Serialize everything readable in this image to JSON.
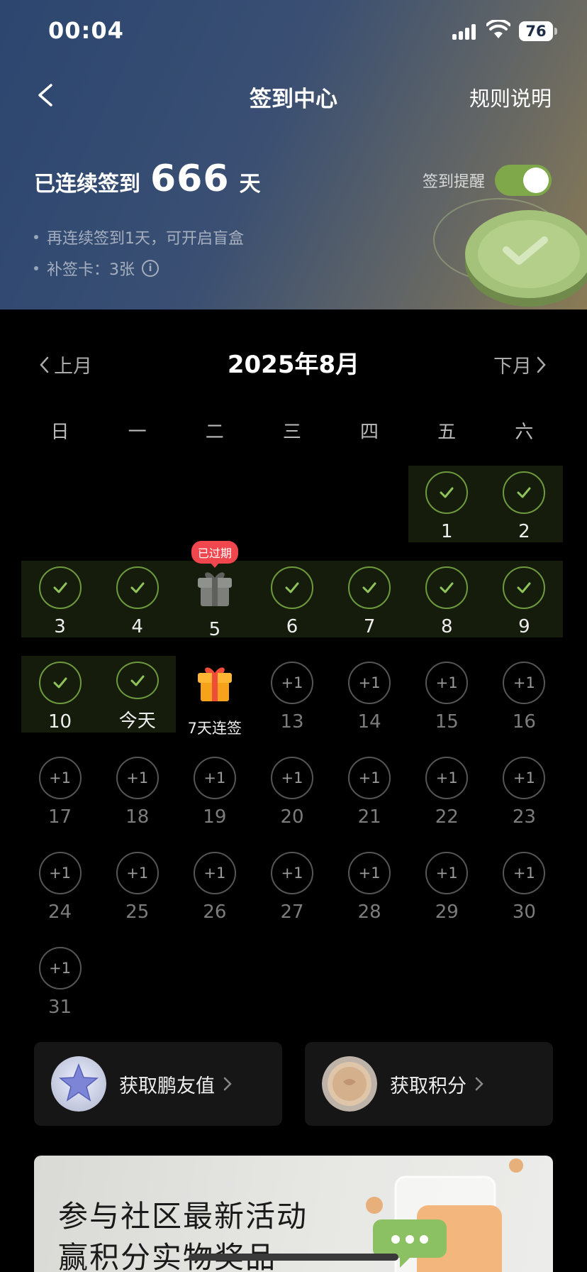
{
  "status_bar": {
    "time": "00:04",
    "battery": "76"
  },
  "nav": {
    "title": "签到中心",
    "rules": "规则说明"
  },
  "streak": {
    "label": "已连续签到",
    "count": "666",
    "unit": "天"
  },
  "reminder": {
    "label": "签到提醒",
    "enabled": true
  },
  "tips": [
    "再连续签到1天，可开启盲盒",
    "补签卡：3张"
  ],
  "calendar": {
    "prev": "上月",
    "next": "下月",
    "title": "2025年8月",
    "weekdays": [
      "日",
      "一",
      "二",
      "三",
      "四",
      "五",
      "六"
    ],
    "expired_badge": "已过期",
    "plus_label": "+1",
    "days": [
      {
        "label": "1",
        "state": "checked"
      },
      {
        "label": "2",
        "state": "checked"
      },
      {
        "label": "3",
        "state": "checked"
      },
      {
        "label": "4",
        "state": "checked"
      },
      {
        "label": "5",
        "state": "expired-gift"
      },
      {
        "label": "6",
        "state": "checked"
      },
      {
        "label": "7",
        "state": "checked"
      },
      {
        "label": "8",
        "state": "checked"
      },
      {
        "label": "9",
        "state": "checked"
      },
      {
        "label": "10",
        "state": "checked"
      },
      {
        "label": "今天",
        "state": "checked"
      },
      {
        "label": "7天连签",
        "state": "gift"
      },
      {
        "label": "13",
        "state": "plus"
      },
      {
        "label": "14",
        "state": "plus"
      },
      {
        "label": "15",
        "state": "plus"
      },
      {
        "label": "16",
        "state": "plus"
      },
      {
        "label": "17",
        "state": "plus"
      },
      {
        "label": "18",
        "state": "plus"
      },
      {
        "label": "19",
        "state": "plus"
      },
      {
        "label": "20",
        "state": "plus"
      },
      {
        "label": "21",
        "state": "plus"
      },
      {
        "label": "22",
        "state": "plus"
      },
      {
        "label": "23",
        "state": "plus"
      },
      {
        "label": "24",
        "state": "plus"
      },
      {
        "label": "25",
        "state": "plus"
      },
      {
        "label": "26",
        "state": "plus"
      },
      {
        "label": "27",
        "state": "plus"
      },
      {
        "label": "28",
        "state": "plus"
      },
      {
        "label": "29",
        "state": "plus"
      },
      {
        "label": "30",
        "state": "plus"
      },
      {
        "label": "31",
        "state": "plus"
      }
    ]
  },
  "cards": [
    {
      "label": "获取鹏友值",
      "icon": "star-badge-icon"
    },
    {
      "label": "获取积分",
      "icon": "coin-icon"
    }
  ],
  "banner": {
    "line1": "参与社区最新活动",
    "line2": "赢积分实物奖品"
  },
  "colors": {
    "accent_green": "#7fa84a",
    "checked_band": "#161c0c",
    "badge_red": "#f0464d"
  }
}
